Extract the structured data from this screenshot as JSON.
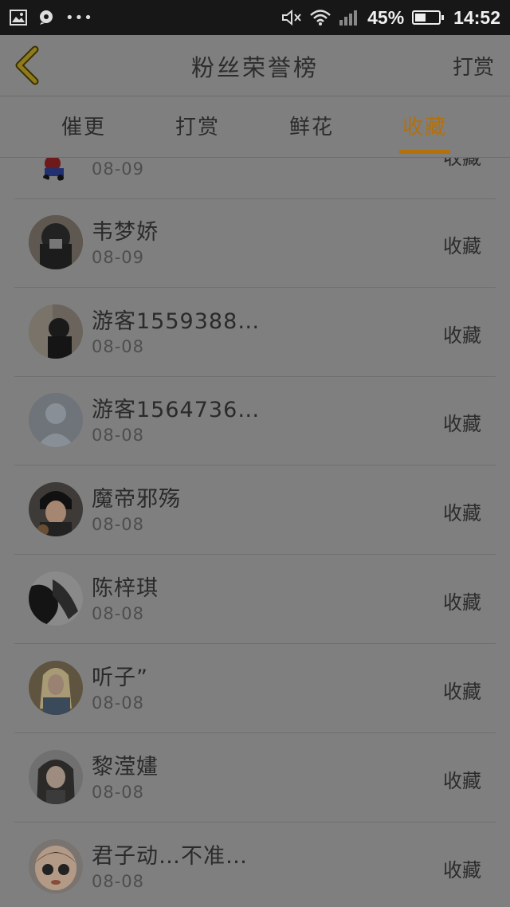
{
  "status_bar": {
    "battery": "45%",
    "battery_level": 0.45,
    "time": "14:52",
    "icons": [
      "image-icon",
      "notification-icon",
      "more-dots-icon",
      "mute-icon",
      "wifi-icon",
      "signal-icon",
      "battery-icon"
    ]
  },
  "header": {
    "title": "粉丝荣誉榜",
    "right_action": "打赏"
  },
  "tabs": [
    {
      "label": "催更"
    },
    {
      "label": "打赏"
    },
    {
      "label": "鲜花"
    },
    {
      "label": "收藏",
      "active": true
    }
  ],
  "colors": {
    "accent": "#b3700c",
    "background": "#7f7f7f"
  },
  "rows": [
    {
      "name": "",
      "date": "08-09",
      "action": "收藏"
    },
    {
      "name": "韦梦娇",
      "date": "08-09",
      "action": "收藏"
    },
    {
      "name": "游客1559388…",
      "date": "08-08",
      "action": "收藏"
    },
    {
      "name": "游客1564736…",
      "date": "08-08",
      "action": "收藏"
    },
    {
      "name": "魔帝邪殇",
      "date": "08-08",
      "action": "收藏"
    },
    {
      "name": "陈梓琪",
      "date": "08-08",
      "action": "收藏"
    },
    {
      "name": "听子”",
      "date": "08-08",
      "action": "收藏"
    },
    {
      "name": "黎滢嫿",
      "date": "08-08",
      "action": "收藏"
    },
    {
      "name": "君子动…不准…",
      "date": "08-08",
      "action": "收藏"
    }
  ]
}
